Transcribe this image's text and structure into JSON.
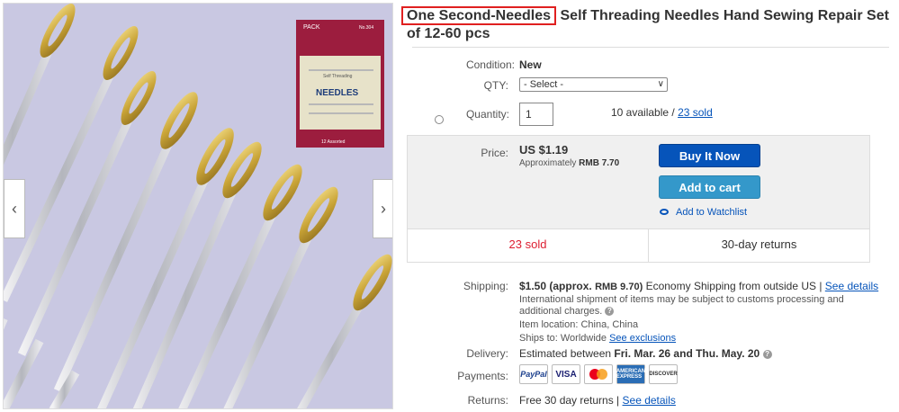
{
  "title": {
    "brand": "One Second-Needles",
    "rest": " Self Threading Needles Hand Sewing Repair Set of 12-60 pcs"
  },
  "gallery": {
    "prev_label": "‹",
    "next_label": "›",
    "package": {
      "brand": "PACK",
      "code": "No.304",
      "subtitle": "Self Threading",
      "name": "NEEDLES",
      "footer": "12 Assorted"
    }
  },
  "details": {
    "condition_label": "Condition:",
    "condition_value": "New",
    "qty_label": "QTY:",
    "qty_select": "- Select -",
    "quantity_label": "Quantity:",
    "quantity_value": "1",
    "available_text": "10 available / ",
    "sold_link": "23 sold"
  },
  "buybox": {
    "price_label": "Price:",
    "price": "US $1.19",
    "approx_prefix": "Approximately ",
    "approx_value": "RMB 7.70",
    "buy_now": "Buy It Now",
    "add_to_cart": "Add to cart",
    "watchlist": "Add to Watchlist",
    "sold_count": "23 sold",
    "returns": "30-day returns"
  },
  "shipping": {
    "label": "Shipping:",
    "cost": "$1.50",
    "approx": "(approx.",
    "approx_value": "RMB 9.70)",
    "method": " Economy Shipping from outside US | ",
    "see_details": "See details",
    "intl_note": "International shipment of items may be subject to customs processing and additional charges.",
    "location": "Item location:  China, China",
    "ships_to": "Ships to:  Worldwide  ",
    "see_exclusions": "See exclusions"
  },
  "delivery": {
    "label": "Delivery:",
    "prefix": "Estimated between ",
    "range": "Fri. Mar. 26 and Thu. May. 20"
  },
  "payments": {
    "label": "Payments:",
    "methods": [
      "PayPal",
      "VISA",
      "MasterCard",
      "AMERICAN EXPRESS",
      "DISCOVER"
    ]
  },
  "returns": {
    "label": "Returns:",
    "text": "Free 30 day returns | ",
    "see_details": "See details"
  },
  "colors": {
    "buy_button": "#0654ba",
    "cart_button": "#3498ca",
    "sold_red": "#dd1e31",
    "highlight_box": "#e02020"
  }
}
